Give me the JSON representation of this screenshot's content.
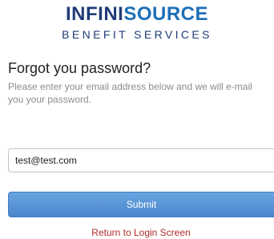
{
  "brand": {
    "name_part1": "INFINI",
    "name_part2": "SOURCE",
    "tagline": "BENEFIT SERVICES"
  },
  "form": {
    "heading": "Forgot you password?",
    "instructions": "Please enter your email address below and we will e-mail you your password.",
    "email_value": "test@test.com",
    "submit_label": "Submit",
    "return_link_label": "Return to Login Screen"
  },
  "colors": {
    "brand_dark": "#1f3c78",
    "brand_accent": "#1e6fb6",
    "button": "#5a96d6",
    "link": "#b02a2a"
  }
}
